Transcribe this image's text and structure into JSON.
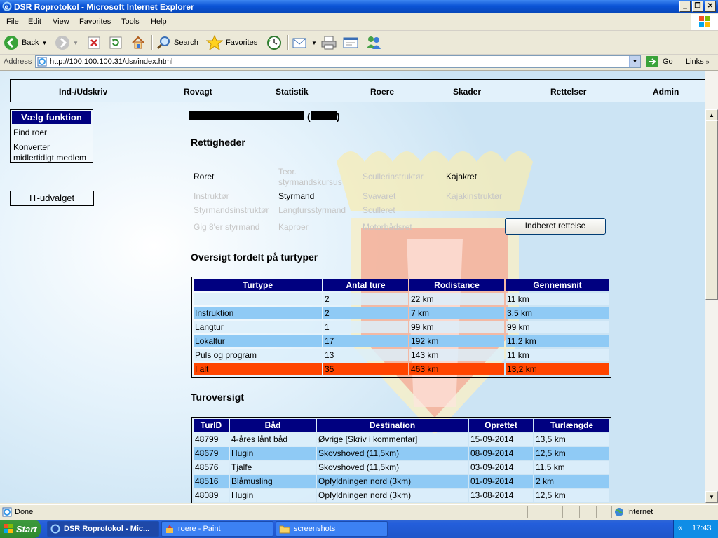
{
  "window": {
    "title": "DSR Roprotokol - Microsoft Internet Explorer"
  },
  "menubar": [
    "File",
    "Edit",
    "View",
    "Favorites",
    "Tools",
    "Help"
  ],
  "toolbar": {
    "back": "Back",
    "search": "Search",
    "favorites": "Favorites"
  },
  "address": {
    "label": "Address",
    "url": "http://100.100.100.31/dsr/index.html",
    "go": "Go",
    "links": "Links"
  },
  "nav": [
    "Ind-/Udskriv",
    "Rovagt",
    "Statistik",
    "Roere",
    "Skader",
    "Rettelser",
    "Admin"
  ],
  "sidebar": {
    "header": "Vælg funktion",
    "links": [
      "Find roer",
      "Konverter midlertidigt medlem"
    ],
    "it_button": "IT-udvalget"
  },
  "member": {
    "open_paren": "(",
    "close_paren": ")"
  },
  "rights": {
    "heading": "Rettigheder",
    "items": [
      {
        "label": "Roret",
        "active": true
      },
      {
        "label": "Teor. styrmandskursus",
        "active": false
      },
      {
        "label": "Scullerinstruktør",
        "active": false
      },
      {
        "label": "Kajakret",
        "active": true
      },
      {
        "label": "Instruktør",
        "active": false
      },
      {
        "label": "Styrmand",
        "active": true
      },
      {
        "label": "Svavaret",
        "active": false
      },
      {
        "label": "Kajakinstruktør",
        "active": false
      },
      {
        "label": "Styrmandsinstruktør",
        "active": false
      },
      {
        "label": "Langtursstyrmand",
        "active": false
      },
      {
        "label": "Sculleret",
        "active": false
      },
      {
        "label": "Gig 8'er styrmand",
        "active": false
      },
      {
        "label": "Kaproer",
        "active": false
      },
      {
        "label": "Motorbådsret",
        "active": false
      }
    ],
    "button": "Indberet rettelse"
  },
  "overview": {
    "heading": "Oversigt fordelt på turtyper",
    "columns": [
      "Turtype",
      "Antal ture",
      "Rodistance",
      "Gennemsnit"
    ],
    "rows": [
      {
        "type": "",
        "count": "2",
        "distance": "22 km",
        "avg": "11 km",
        "style": "light"
      },
      {
        "type": "Instruktion",
        "count": "2",
        "distance": "7 km",
        "avg": "3,5 km",
        "style": "dark"
      },
      {
        "type": "Langtur",
        "count": "1",
        "distance": "99 km",
        "avg": "99 km",
        "style": "light"
      },
      {
        "type": "Lokaltur",
        "count": "17",
        "distance": "192 km",
        "avg": "11,2 km",
        "style": "dark"
      },
      {
        "type": "Puls og program",
        "count": "13",
        "distance": "143 km",
        "avg": "11 km",
        "style": "light"
      },
      {
        "type": "I alt",
        "count": "35",
        "distance": "463 km",
        "avg": "13,2 km",
        "style": "total"
      }
    ]
  },
  "trips": {
    "heading": "Turoversigt",
    "columns": [
      "TurID",
      "Båd",
      "Destination",
      "Oprettet",
      "Turlængde"
    ],
    "rows": [
      {
        "id": "48799",
        "boat": "4-åres lånt båd",
        "dest": "Øvrige [Skriv i kommentar]",
        "date": "15-09-2014",
        "len": "13,5 km",
        "style": "light"
      },
      {
        "id": "48679",
        "boat": "Hugin",
        "dest": "Skovshoved (11,5km)",
        "date": "08-09-2014",
        "len": "12,5 km",
        "style": "dark"
      },
      {
        "id": "48576",
        "boat": "Tjalfe",
        "dest": "Skovshoved (11,5km)",
        "date": "03-09-2014",
        "len": "11,5 km",
        "style": "light"
      },
      {
        "id": "48516",
        "boat": "Blåmusling",
        "dest": "Opfyldningen nord (3km)",
        "date": "01-09-2014",
        "len": "2 km",
        "style": "dark"
      },
      {
        "id": "48089",
        "boat": "Hugin",
        "dest": "Opfyldningen nord (3km)",
        "date": "13-08-2014",
        "len": "12,5 km",
        "style": "light"
      }
    ]
  },
  "status": {
    "text": "Done",
    "zone": "Internet"
  },
  "taskbar": {
    "start": "Start",
    "tasks": [
      "DSR Roprotokol - Mic...",
      "roere - Paint",
      "screenshots"
    ],
    "tray_chevron": "«",
    "clock": "17:43"
  }
}
